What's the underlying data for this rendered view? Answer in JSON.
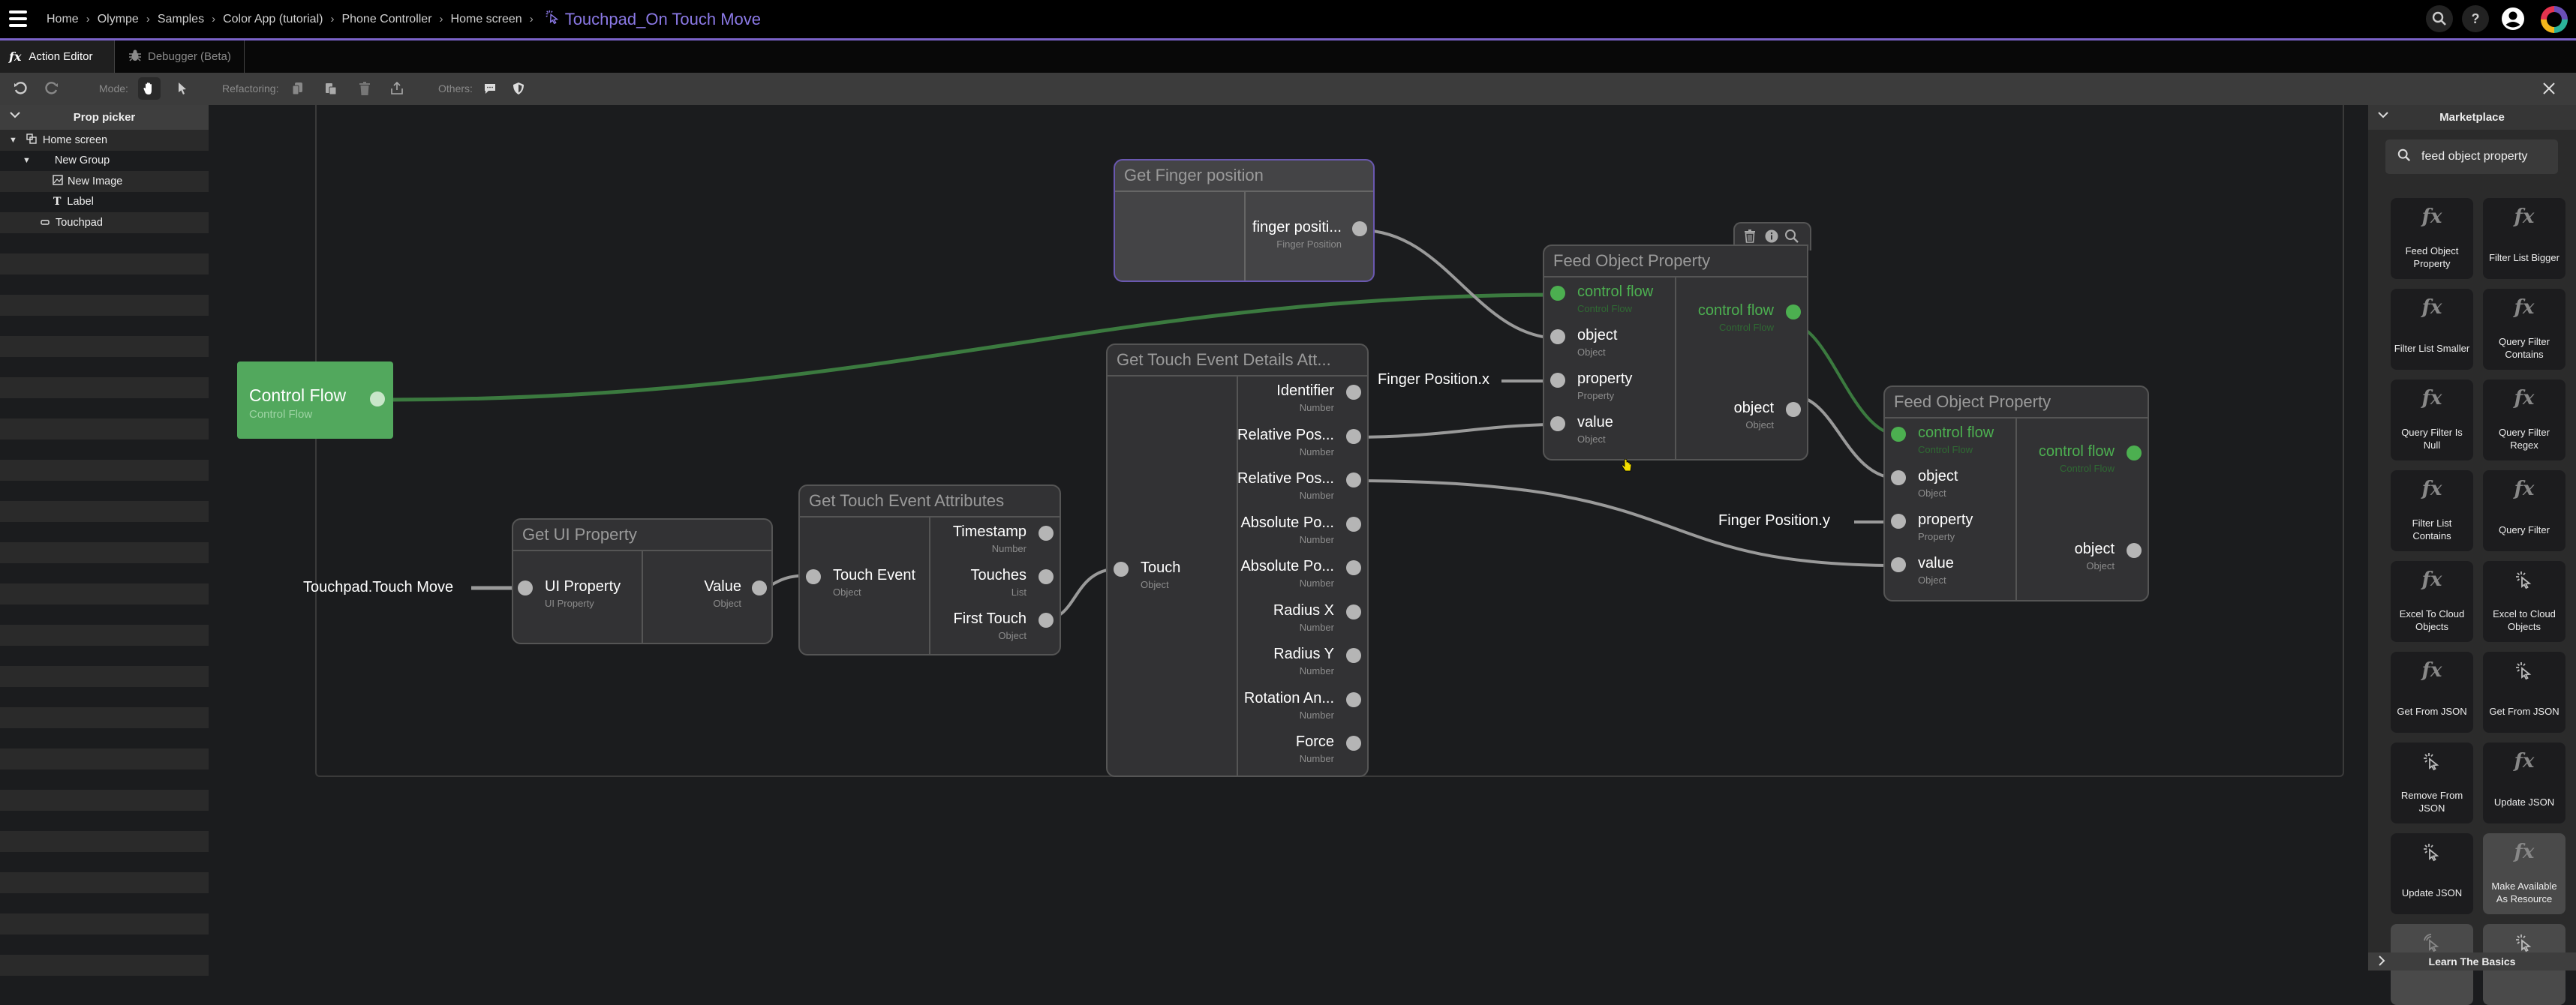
{
  "header": {
    "breadcrumb": [
      "Home",
      "Olympe",
      "Samples",
      "Color App (tutorial)",
      "Phone Controller",
      "Home screen"
    ],
    "current": "Touchpad_On Touch Move",
    "icons": [
      "search-icon",
      "help-icon",
      "account-icon",
      "app-logo"
    ]
  },
  "tabs": [
    {
      "label": "Action Editor",
      "icon": "fx-icon",
      "active": true
    },
    {
      "label": "Debugger (Beta)",
      "icon": "bug-icon",
      "active": false
    }
  ],
  "toolbar": {
    "mode_label": "Mode:",
    "refactoring_label": "Refactoring:",
    "others_label": "Others:"
  },
  "prop_picker": {
    "title": "Prop picker",
    "items": [
      {
        "label": "Home screen",
        "icon": "screen-icon",
        "level": 0,
        "expanded": true
      },
      {
        "label": "New Group",
        "icon": "",
        "level": 1,
        "expanded": true
      },
      {
        "label": "New Image",
        "icon": "image-icon",
        "level": 2
      },
      {
        "label": "Label",
        "icon": "text-icon",
        "level": 2
      },
      {
        "label": "Touchpad",
        "icon": "touchpad-icon",
        "level": 1
      }
    ]
  },
  "canvas": {
    "control_flow": {
      "title": "Control Flow",
      "type": "Control Flow"
    },
    "constants": {
      "touch_move": "Touchpad.Touch Move",
      "finger_x": "Finger Position.x",
      "finger_y": "Finger Position.y"
    },
    "get_ui_property": {
      "title": "Get UI Property",
      "inputs": [
        {
          "name": "UI Property",
          "type": "UI Property"
        }
      ],
      "outputs": [
        {
          "name": "Value",
          "type": "Object"
        }
      ]
    },
    "get_touch_event_attributes": {
      "title": "Get Touch Event Attributes",
      "inputs": [
        {
          "name": "Touch Event",
          "type": "Object"
        }
      ],
      "outputs": [
        {
          "name": "Timestamp",
          "type": "Number"
        },
        {
          "name": "Touches",
          "type": "List"
        },
        {
          "name": "First Touch",
          "type": "Object"
        }
      ]
    },
    "get_touch_event_details": {
      "title": "Get Touch Event Details Att...",
      "inputs": [
        {
          "name": "Touch",
          "type": "Object"
        }
      ],
      "outputs": [
        {
          "name": "Identifier",
          "type": "Number"
        },
        {
          "name": "Relative Pos...",
          "type": "Number"
        },
        {
          "name": "Relative Pos...",
          "type": "Number"
        },
        {
          "name": "Absolute Po...",
          "type": "Number"
        },
        {
          "name": "Absolute Po...",
          "type": "Number"
        },
        {
          "name": "Radius X",
          "type": "Number"
        },
        {
          "name": "Radius Y",
          "type": "Number"
        },
        {
          "name": "Rotation An...",
          "type": "Number"
        },
        {
          "name": "Force",
          "type": "Number"
        }
      ]
    },
    "get_finger_position": {
      "title": "Get Finger position",
      "outputs": [
        {
          "name": "finger positi...",
          "type": "Finger Position"
        }
      ]
    },
    "feed_object_property_1": {
      "title": "Feed Object Property",
      "inputs": [
        {
          "name": "control flow",
          "type": "Control Flow"
        },
        {
          "name": "object",
          "type": "Object"
        },
        {
          "name": "property",
          "type": "Property"
        },
        {
          "name": "value",
          "type": "Object"
        }
      ],
      "outputs": [
        {
          "name": "control flow",
          "type": "Control Flow"
        },
        {
          "name": "object",
          "type": "Object"
        }
      ]
    },
    "feed_object_property_2": {
      "title": "Feed Object Property",
      "inputs": [
        {
          "name": "control flow",
          "type": "Control Flow"
        },
        {
          "name": "object",
          "type": "Object"
        },
        {
          "name": "property",
          "type": "Property"
        },
        {
          "name": "value",
          "type": "Object"
        }
      ],
      "outputs": [
        {
          "name": "control flow",
          "type": "Control Flow"
        },
        {
          "name": "object",
          "type": "Object"
        }
      ]
    }
  },
  "marketplace": {
    "title": "Marketplace",
    "search_value": "feed object property",
    "items": [
      {
        "label": "Feed Object Property",
        "icon": "fx"
      },
      {
        "label": "Filter List Bigger",
        "icon": "fx"
      },
      {
        "label": "Filter List Smaller",
        "icon": "fx"
      },
      {
        "label": "Query Filter Contains",
        "icon": "fx"
      },
      {
        "label": "Query Filter Is Null",
        "icon": "fx"
      },
      {
        "label": "Query Filter Regex",
        "icon": "fx"
      },
      {
        "label": "Filter List Contains",
        "icon": "fx"
      },
      {
        "label": "Query Filter",
        "icon": "fx"
      },
      {
        "label": "Excel To Cloud Objects",
        "icon": "fx"
      },
      {
        "label": "Excel to Cloud Objects",
        "icon": "click"
      },
      {
        "label": "Get From JSON",
        "icon": "fx"
      },
      {
        "label": "Get From JSON",
        "icon": "click"
      },
      {
        "label": "Remove From JSON",
        "icon": "click"
      },
      {
        "label": "Update JSON",
        "icon": "fx"
      },
      {
        "label": "Update JSON",
        "icon": "click"
      },
      {
        "label": "Make Available As Resource",
        "icon": "fx"
      },
      {
        "label": "",
        "icon": "wifi-click"
      },
      {
        "label": "",
        "icon": "click"
      }
    ],
    "footer": "Learn The Basics"
  },
  "colors": {
    "accent": "#7a62c8",
    "control_flow": "#4caf50",
    "control_flow_node": "#52a85d",
    "wire": "#9a9a9a",
    "wire_green": "#3b7a3f"
  }
}
